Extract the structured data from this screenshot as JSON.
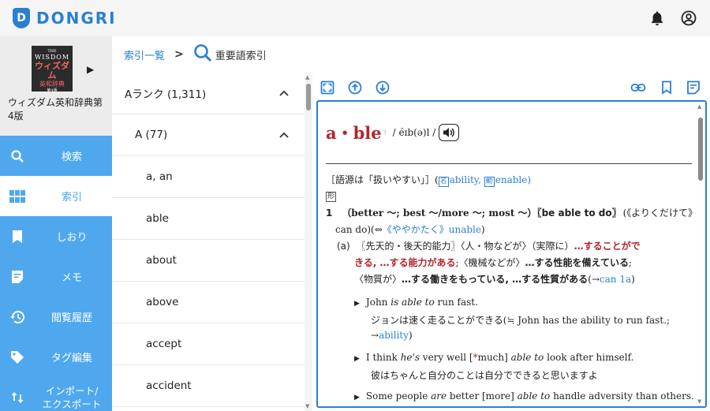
{
  "header": {
    "brand_letter": "D",
    "brand": "DONGRI",
    "bell_icon": "bell-icon",
    "account_icon": "account-circle-icon",
    "accent_color": "#2a7fd4"
  },
  "book": {
    "cover_line1": "THE",
    "cover_line2": "WISDOM",
    "cover_line3": "ウィズダム",
    "cover_line4": "英和辞典",
    "cover_line5": "第4版",
    "title": "ウィズダム英和辞典第4版"
  },
  "sidebar": {
    "color": "#4fa8ee",
    "items": [
      {
        "label": "検索",
        "icon": "search-icon"
      },
      {
        "label": "索引",
        "icon": "grid-icon"
      },
      {
        "label": "しおり",
        "icon": "bookmark-icon"
      },
      {
        "label": "メモ",
        "icon": "memo-icon"
      },
      {
        "label": "閲覧履歴",
        "icon": "history-icon"
      },
      {
        "label": "タグ編集",
        "icon": "tag-icon"
      },
      {
        "label_line1": "インポート/",
        "label_line2": "エクスポート",
        "icon": "import-export-icon"
      }
    ]
  },
  "breadcrumb": {
    "parent": "索引一覧",
    "separator": ">",
    "current": "重要語索引"
  },
  "list": {
    "groups": [
      {
        "label": "Aランク (1,311)"
      },
      {
        "label": "A (77)"
      }
    ],
    "items": [
      "a, an",
      "able",
      "about",
      "above",
      "accept",
      "accident"
    ]
  },
  "entry": {
    "headword": "a・ble",
    "stress_mark": "⋮",
    "pronunciation": "/ éɪb(ə)l /",
    "etym_open": "［語源は「扱いやすい」］",
    "etym_paren_open": "(",
    "etym_tag1": "名",
    "etym_word1": "ability,",
    "etym_tag2": "動",
    "etym_word2": "enable)",
    "pos_tag": "形",
    "sense1_num": "1",
    "sense1_forms": "（better ～; best ～/more ～; most ～）",
    "sense1_pattern": "〖be able to do〗",
    "sense1_note": "(《よりくだけて》can do)(⇔",
    "sense1_note_blue": "《ややかたく》unable",
    "sense1_note_end": ")",
    "a_label": "(a)",
    "a_line1_pre": "〖先天的・後天的能力〗〈人・物などが〉（実際に）",
    "a_line1_red": "…することがで",
    "a_line2_red": "きる, …する能力がある",
    "a_line2_post": ";〈機械などが〉",
    "a_line2_bold": "…する性能を備えている",
    "a_line2_end": ";",
    "a_line3_pre": "〈物質が〉",
    "a_line3_bold": "…する働きをもっている, …する性質がある",
    "a_line3_arrow": "(→",
    "a_line3_link": "can 1a",
    "a_line3_end": ")",
    "ex1_en_pre": "John ",
    "ex1_en_it": "is able to",
    "ex1_en_post": " run fast.",
    "ex1_ja": "ジョンは速く走ることができる(≒ John has the ability to run fast.;",
    "ex1_arrow": "→",
    "ex1_link": "ability",
    "ex1_link_end": ")",
    "ex2_en_pre": "I think ",
    "ex2_en_it1": "he's",
    "ex2_en_mid": " very well [",
    "ex2_en_star": "*",
    "ex2_en_mid2": "much] ",
    "ex2_en_it2": "able to",
    "ex2_en_post": " look after himself.",
    "ex2_ja": "彼はちゃんと自分のことは自分でできると思いますよ",
    "ex3_en_pre": "Some people ",
    "ex3_en_it1": "are",
    "ex3_en_mid": " better [more] ",
    "ex3_en_it2": "able to",
    "ex3_en_post": " handle adversity than others.",
    "headword_color": "#b3262c"
  }
}
